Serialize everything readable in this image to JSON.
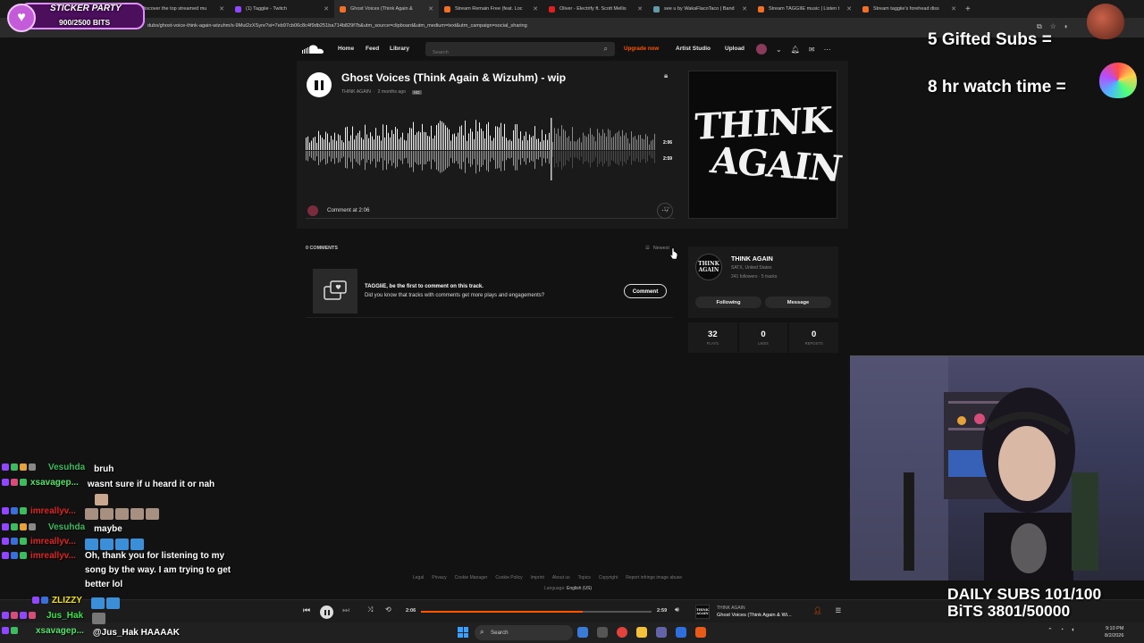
{
  "browser": {
    "tabs": [
      {
        "label": "Discover the top streamed mu",
        "icon": "soundcloud-icon",
        "active": false
      },
      {
        "label": "(1) Taggiie - Twitch",
        "icon": "twitch-icon",
        "active": false
      },
      {
        "label": "Ghost Voices (Think Again &",
        "icon": "soundcloud-icon",
        "active": true
      },
      {
        "label": "Stream Remain Free (feat. Loc",
        "icon": "soundcloud-icon",
        "active": false
      },
      {
        "label": "Oliver - Electrify ft. Scott Mellis",
        "icon": "youtube-icon",
        "active": false
      },
      {
        "label": "see u by WakaFlacoTaco | Band",
        "icon": "bandcamp-icon",
        "active": false
      },
      {
        "label": "Stream TAGGIIE music | Listen t",
        "icon": "soundcloud-icon",
        "active": false
      },
      {
        "label": "Stream taggiie's forehead diss",
        "icon": "soundcloud-icon",
        "active": false
      }
    ],
    "url": "dubs/ghost-voice-think-again-wizuhm/s-9Mut2zXSyre?si=7eb97cb06c8c4f9db251ba714b829f7b&utm_source=clipboard&utm_medium=text&utm_campaign=social_sharing"
  },
  "header": {
    "nav": [
      "Home",
      "Feed",
      "Library"
    ],
    "search_placeholder": "Search",
    "upgrade": "Upgrade now",
    "artist_studio": "Artist Studio",
    "upload": "Upload"
  },
  "track": {
    "title": "Ghost Voices (Think Again & Wizuhm) - wip",
    "artist": "THINK AGAIN",
    "posted": "2 months ago",
    "quality": "HD",
    "current_time": "2:06",
    "duration": "2:59",
    "comment_prompt": "Comment at 2:06",
    "artwork_line1": "THINK",
    "artwork_line2": "AGAIN"
  },
  "comments": {
    "count_label": "0 COMMENTS",
    "sort_label": "Newest",
    "first_line": "TAGGIiE, be the first to comment on this track.",
    "second_line": "Did you know that tracks with comments get more plays and engagements?",
    "button": "Comment"
  },
  "artist_card": {
    "name": "THINK AGAIN",
    "location": "SATX, United States",
    "stats": "241 followers · 5 tracks",
    "avatar_text": "THINK AGAIN",
    "following": "Following",
    "message": "Message"
  },
  "stats": [
    {
      "value": "32",
      "label": "PLAYS"
    },
    {
      "value": "0",
      "label": "LIKES"
    },
    {
      "value": "0",
      "label": "REPOSTS"
    }
  ],
  "footer": {
    "links": [
      "Legal",
      "Privacy",
      "Cookie Manager",
      "Cookie Policy",
      "Imprint",
      "About us",
      "Topics",
      "Copyright",
      "Report infringe image abuse"
    ],
    "language_label": "Language:",
    "language": "English (US)"
  },
  "player": {
    "current": "2:06",
    "total": "2:59",
    "progress": 0.7,
    "artist": "THINK AGAIN",
    "title": "Ghost Voices (Think Again & Wi...",
    "art_text": "THINK AGAIN"
  },
  "taskbar": {
    "search": "Search",
    "time": "9:10 PM",
    "date": "8/2/2026"
  },
  "overlay": {
    "sticker_title": "STICKER PARTY",
    "sticker_bits": "900/2500 BITS",
    "gifted_subs": "5 Gifted Subs =",
    "watch_time": "8 hr watch time =",
    "daily_subs": "DAILY SUBS 101/100",
    "bits": "BiTS 3801/50000"
  },
  "chat": [
    {
      "user": "Vesuhda",
      "color": "#3dbb5e",
      "message": "bruh"
    },
    {
      "user": "xsavagep...",
      "color": "#55e36a",
      "message": "wasnt sure if u heard it or nah"
    },
    {
      "user": "imreallyv...",
      "color": "#e02424",
      "message": ""
    },
    {
      "user": "Vesuhda",
      "color": "#3dbb5e",
      "message": "maybe"
    },
    {
      "user": "imreallyv...",
      "color": "#e02424",
      "message": ""
    },
    {
      "user": "imreallyv...",
      "color": "#e02424",
      "message": "Oh, thank you for listening to my song by the way. I am trying to get better lol"
    },
    {
      "user": "ZLIZZY",
      "color": "#f5e21a",
      "message": ""
    },
    {
      "user": "Jus_Hak",
      "color": "#3de34a",
      "message": ""
    },
    {
      "user": "xsavagep...",
      "color": "#55e36a",
      "message": "@Jus_Hak HAAAAK"
    }
  ],
  "colors": {
    "accent": "#ff5500",
    "background": "#121212",
    "panel": "#1a1a1a"
  }
}
